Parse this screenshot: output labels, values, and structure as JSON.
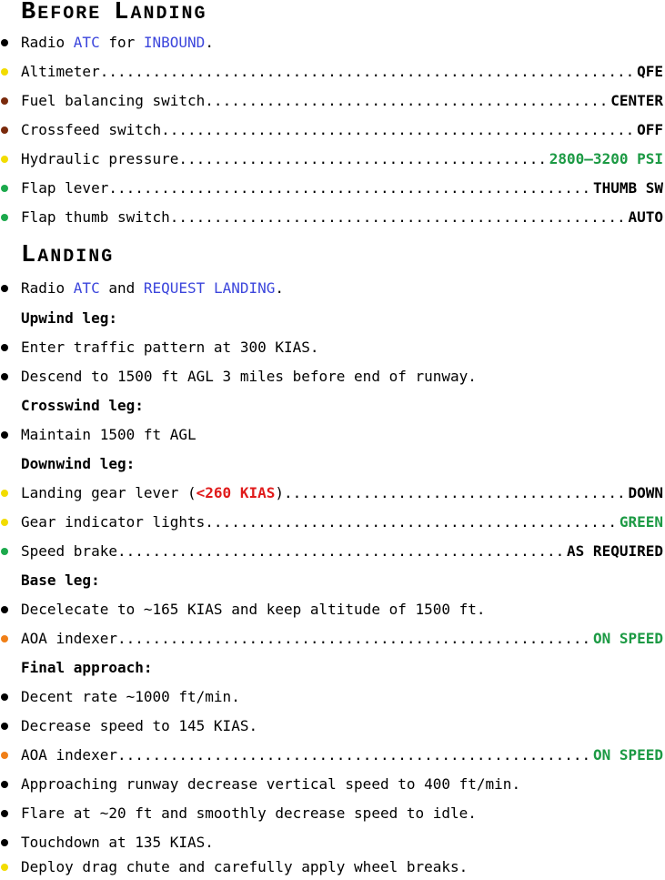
{
  "colors": {
    "bullet_black": "#000000",
    "bullet_yellow": "#f2dc00",
    "bullet_brown": "#7a2a0c",
    "bullet_green": "#1ca94c",
    "bullet_orange": "#f07f17",
    "keyword_blue": "#3c46dc",
    "value_green": "#1c9a44",
    "warning_red": "#e01b1b"
  },
  "before_landing": {
    "title_first_cap": "B",
    "title_first_rest": "EFORE",
    "title_second_cap": "L",
    "title_second_rest": "ANDING",
    "radio": {
      "bullet": "black",
      "prefix": "Radio ",
      "kw1": "ATC",
      "mid": " for ",
      "kw2": "INBOUND",
      "suffix": "."
    },
    "items": [
      {
        "bullet": "yellow",
        "label": "Altimeter",
        "value": "QFE",
        "value_color": "black"
      },
      {
        "bullet": "brown",
        "label": "Fuel balancing switch",
        "value": "CENTER",
        "value_color": "black"
      },
      {
        "bullet": "brown",
        "label": "Crossfeed switch",
        "value": "OFF",
        "value_color": "black"
      },
      {
        "bullet": "yellow",
        "label": "Hydraulic pressure",
        "value": "2800–3200 PSI",
        "value_color": "green"
      },
      {
        "bullet": "green",
        "label": "Flap lever",
        "value": "THUMB SW",
        "value_color": "black"
      },
      {
        "bullet": "green",
        "label": "Flap thumb switch",
        "value": "AUTO",
        "value_color": "black"
      }
    ]
  },
  "landing": {
    "title_cap": "L",
    "title_rest": "ANDING",
    "radio": {
      "bullet": "black",
      "prefix": "Radio ",
      "kw1": "ATC",
      "mid": " and ",
      "kw2": "REQUEST LANDING",
      "suffix": "."
    },
    "upwind": {
      "heading": "Upwind leg:",
      "items": [
        {
          "bullet": "black",
          "text": "Enter traffic pattern at 300 KIAS."
        },
        {
          "bullet": "black",
          "text": "Descend to 1500 ft AGL 3 miles before end of runway."
        }
      ]
    },
    "crosswind": {
      "heading": "Crosswind leg:",
      "items": [
        {
          "bullet": "black",
          "text": "Maintain 1500 ft AGL"
        }
      ]
    },
    "downwind": {
      "heading": "Downwind leg:",
      "gear": {
        "bullet": "yellow",
        "label_pre": "Landing gear lever (",
        "label_warn": "<260 KIAS",
        "label_post": ")",
        "value": "DOWN"
      },
      "items": [
        {
          "bullet": "yellow",
          "label": "Gear indicator lights",
          "value": "GREEN",
          "value_color": "green"
        },
        {
          "bullet": "green",
          "label": "Speed brake",
          "value": "AS REQUIRED",
          "value_color": "black"
        }
      ]
    },
    "base": {
      "heading": "Base leg:",
      "text_item": {
        "bullet": "black",
        "text": "Decelecate to ~165 KIAS and keep altitude of 1500 ft."
      },
      "check_item": {
        "bullet": "orange",
        "label": "AOA indexer",
        "value": "ON SPEED",
        "value_color": "green"
      }
    },
    "final": {
      "heading": "Final approach:",
      "item1": {
        "bullet": "black",
        "text": "Decent rate ~1000 ft/min."
      },
      "item2": {
        "bullet": "black",
        "text": "Decrease speed to 145 KIAS."
      },
      "check_item": {
        "bullet": "orange",
        "label": "AOA indexer",
        "value": "ON SPEED",
        "value_color": "green"
      },
      "items_after": [
        {
          "bullet": "black",
          "text": "Approaching runway decrease vertical speed to 400 ft/min."
        },
        {
          "bullet": "black",
          "text": "Flare at ~20 ft and smoothly decrease speed to idle."
        },
        {
          "bullet": "black",
          "text": "Touchdown at 135 KIAS."
        },
        {
          "bullet": "yellow",
          "text": "Deploy drag chute and carefully apply wheel breaks."
        }
      ]
    }
  }
}
